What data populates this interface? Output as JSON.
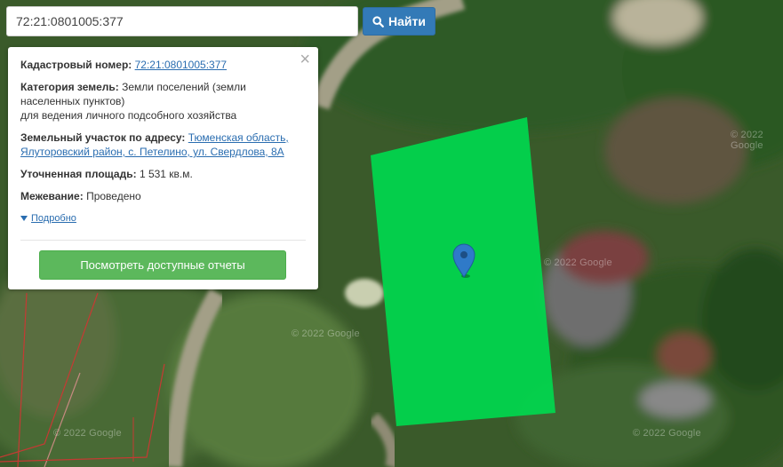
{
  "search": {
    "value": "72:21:0801005:377",
    "button_label": "Найти"
  },
  "popup": {
    "cadastral_label": "Кадастровый номер:",
    "cadastral_value": "72:21:0801005:377",
    "category_label": "Категория земель:",
    "category_line1": "Земли поселений (земли населенных пунктов)",
    "category_line2": "для ведения личного подсобного хозяйства",
    "address_label": "Земельный участок по адресу:",
    "address_value": "Тюменская область, Ялуторовский район, с. Петелино, ул. Свердлова, 8А",
    "area_label": "Уточненная площадь:",
    "area_value": "1 531 кв.м.",
    "survey_label": "Межевание:",
    "survey_value": "Проведено",
    "details_label": "Подробно",
    "reports_button": "Посмотреть доступные отчеты"
  },
  "map": {
    "watermark": "© 2022 Google",
    "parcel_color": "#00d84e",
    "marker_color": "#2f7ac8"
  },
  "icons": {
    "search": "search-icon",
    "close": "close-icon",
    "marker": "map-marker-icon",
    "details": "triangle-down-icon"
  }
}
